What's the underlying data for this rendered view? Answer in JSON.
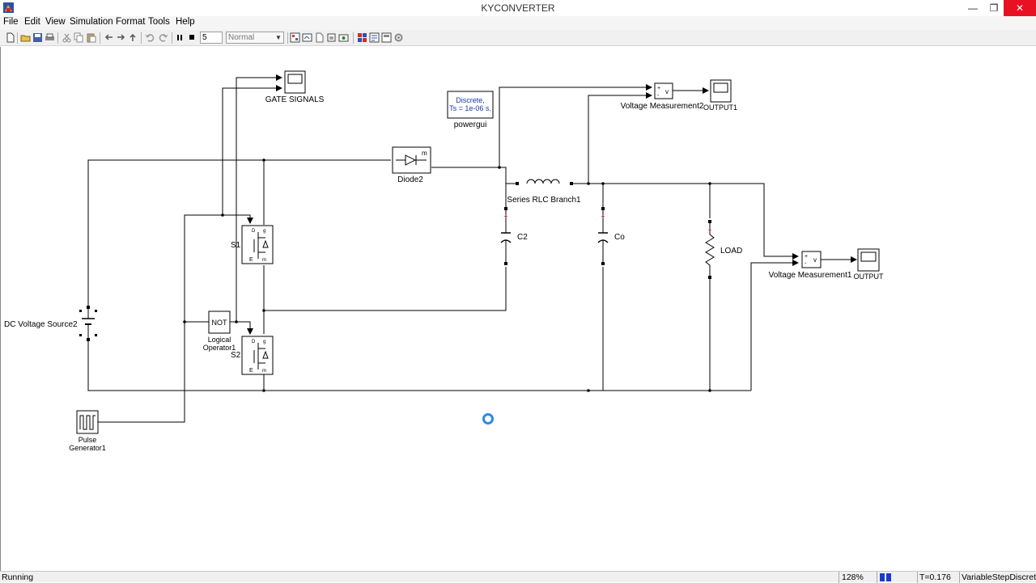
{
  "window": {
    "title": "KYCONVERTER",
    "minimize": "—",
    "maximize": "❐",
    "close": "✕"
  },
  "menu": [
    "File",
    "Edit",
    "View",
    "Simulation",
    "Format",
    "Tools",
    "Help"
  ],
  "toolbar": {
    "stop_time": "5",
    "sim_mode": "Normal"
  },
  "blocks": {
    "gate_scope": "GATE SIGNALS",
    "powergui_line1": "Discrete,",
    "powergui_line2": "Ts = 1e-06 s.",
    "powergui": "powergui",
    "vm2": "Voltage Measurement2",
    "output1": "OUTPUT1",
    "diode": "Diode2",
    "diode_port": "m",
    "rlc": "Series RLC Branch1",
    "c2": "C2",
    "co": "Co",
    "load": "LOAD",
    "vm1": "Voltage Measurement1",
    "output": "OUTPUT",
    "s1": "S1",
    "s2": "S2",
    "dc_source": "DC Voltage Source2",
    "not_label": "NOT",
    "logical_op_1": "Logical",
    "logical_op_2": "Operator1",
    "pulse_1": "Pulse",
    "pulse_2": "Generator1",
    "vm_plus": "+",
    "vm_minus": "-",
    "vm_v": "v",
    "mos_d": "D",
    "mos_g": "g",
    "mos_e": "E",
    "mos_m": "m"
  },
  "status": {
    "state": "Running",
    "zoom": "128%",
    "progress_fraction": 0.035,
    "time": "T=0.176",
    "solver": "VariableStepDiscrete"
  },
  "colors": {
    "close": "#e81123",
    "progress": "#1a3cc8",
    "busy": "#2a8ae6",
    "powergui_text": "#1a3aa8"
  },
  "icons": [
    "app-icon",
    "new-icon",
    "open-icon",
    "save-icon",
    "print-icon",
    "cut-icon",
    "copy-icon",
    "paste-icon",
    "back-icon",
    "forward-icon",
    "up-icon",
    "undo-icon",
    "redo-icon",
    "pause-icon",
    "stop-icon",
    "library-icon",
    "model-explorer-icon",
    "busy-spinner-icon"
  ]
}
